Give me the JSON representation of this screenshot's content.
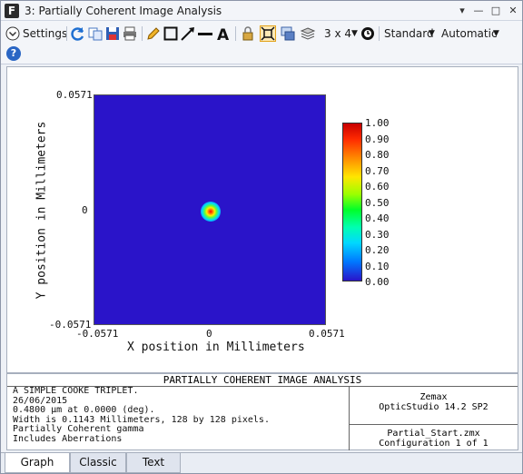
{
  "window": {
    "title": "3: Partially Coherent Image Analysis",
    "app_icon": "F"
  },
  "toolbar": {
    "settings_label": "Settings",
    "layout_label": "3 x 4",
    "standard_label": "Standard",
    "automatic_label": "Automatic"
  },
  "plot": {
    "y_top": "0.0571",
    "y_mid": "0",
    "y_bottom": "-0.0571",
    "x_left": "-0.0571",
    "x_mid": "0",
    "x_right": "0.0571",
    "xlabel": "X position in Millimeters",
    "ylabel": "Y position in Millimeters"
  },
  "colorbar": {
    "ticks": [
      "1.00",
      "0.90",
      "0.80",
      "0.70",
      "0.60",
      "0.50",
      "0.40",
      "0.30",
      "0.20",
      "0.10",
      "0.00"
    ]
  },
  "info": {
    "title": "PARTIALLY COHERENT IMAGE ANALYSIS",
    "lines": [
      "A SIMPLE COOKE TRIPLET.",
      "26/06/2015",
      "0.4800 µm at 0.0000 (deg).",
      "Width is 0.1143 Millimeters, 128 by 128 pixels.",
      "Partially Coherent gamma",
      "Includes Aberrations"
    ],
    "company": "Zemax",
    "product": "OpticStudio 14.2 SP2",
    "file": "Partial_Start.zmx",
    "config": "Configuration 1 of 1"
  },
  "tabs": {
    "graph": "Graph",
    "classic": "Classic",
    "text": "Text"
  }
}
